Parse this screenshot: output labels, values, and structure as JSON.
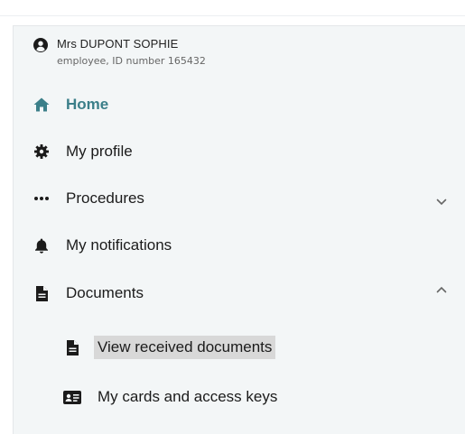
{
  "user": {
    "name": "Mrs DUPONT SOPHIE",
    "role": "employee, ID number 165432",
    "icon": "user-circle-icon"
  },
  "nav": {
    "items": [
      {
        "label": "Home",
        "icon": "home-icon",
        "active": true
      },
      {
        "label": "My profile",
        "icon": "gear-icon"
      },
      {
        "label": "Procedures",
        "icon": "ellipsis-icon",
        "expandable": "collapsed"
      },
      {
        "label": "My notifications",
        "icon": "bell-icon"
      },
      {
        "label": "Documents",
        "icon": "document-icon",
        "expandable": "expanded"
      }
    ],
    "documents_children": [
      {
        "label": "View received documents",
        "icon": "document-icon",
        "selected": true
      },
      {
        "label": "My cards and access keys",
        "icon": "id-card-icon"
      }
    ]
  },
  "colors": {
    "active": "#3b7f89",
    "panel_bg": "#f3f6f7",
    "highlight_bg": "#d8d8d8",
    "text": "#1b1b1b"
  }
}
